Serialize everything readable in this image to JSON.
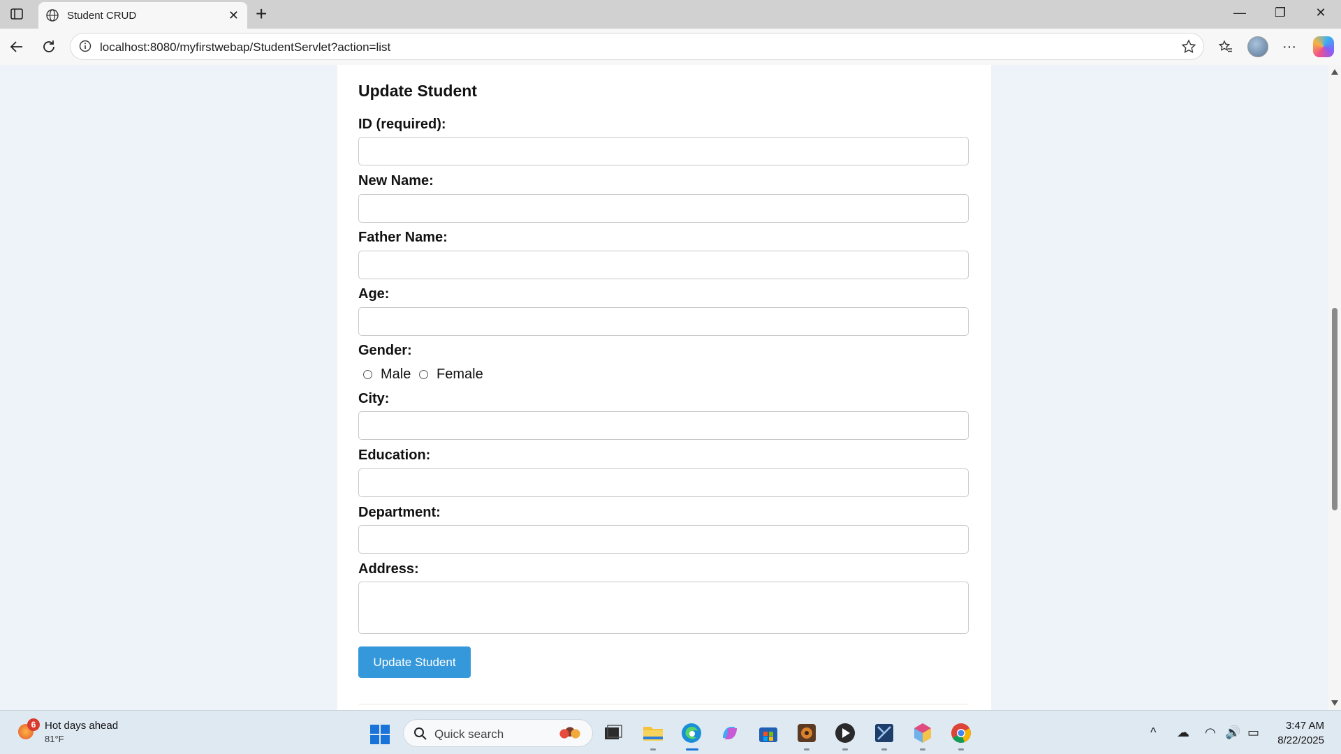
{
  "browser": {
    "tab_title": "Student CRUD",
    "tab_close": "✕",
    "new_tab": "+",
    "url": "localhost:8080/myfirstwebap/StudentServlet?action=list",
    "window": {
      "minimize": "—",
      "restore": "❐",
      "close": "✕"
    },
    "more": "···"
  },
  "form": {
    "title": "Update Student",
    "fields": {
      "id": {
        "label": "ID (required):",
        "value": ""
      },
      "name": {
        "label": "New Name:",
        "value": ""
      },
      "father_name": {
        "label": "Father Name:",
        "value": ""
      },
      "age": {
        "label": "Age:",
        "value": ""
      },
      "gender": {
        "label": "Gender:",
        "options": [
          "Male",
          "Female"
        ],
        "selected": ""
      },
      "city": {
        "label": "City:",
        "value": ""
      },
      "education": {
        "label": "Education:",
        "value": ""
      },
      "department": {
        "label": "Department:",
        "value": ""
      },
      "address": {
        "label": "Address:",
        "value": ""
      }
    },
    "submit_label": "Update Student"
  },
  "taskbar": {
    "weather": {
      "badge": "6",
      "title": "Hot days ahead",
      "temp": "81°F"
    },
    "search_placeholder": "Quick search",
    "apps": [
      "task-view",
      "file-explorer",
      "edge",
      "copilot",
      "microsoft-store",
      "app-5",
      "media-player",
      "app-7",
      "app-8",
      "chrome"
    ],
    "tray": {
      "chevron": "^",
      "onedrive": "☁",
      "wifi": "◠",
      "volume": "🔊",
      "battery": "▭"
    },
    "clock": {
      "time": "3:47 AM",
      "date": "8/22/2025"
    }
  },
  "colors": {
    "accent_button": "#3498db",
    "page_bg": "#edf3f8",
    "card_bg": "#ffffff"
  }
}
